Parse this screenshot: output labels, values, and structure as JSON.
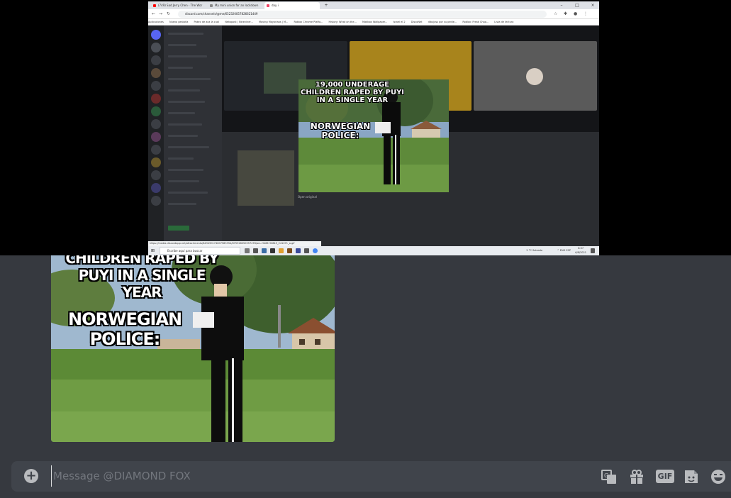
{
  "browser": {
    "tabs": [
      {
        "label": "(749) Sad Jerry Chen - The Wor",
        "color": "#ff0000"
      },
      {
        "label": "My mini union for an lockdown",
        "color": "#888888"
      },
      {
        "label": "day i",
        "color": "#ee4466"
      }
    ],
    "url": "discord.com/channels/@me/652320057826621449",
    "bookmarks": [
      "Aplicaciones",
      "Nuevo pestaña",
      "Pokec de aca la cual",
      "Nekopost | Nineviner...",
      "Moving Mayoriaos | M...",
      "Roblox Chrome Platfo...",
      "History: What on the...",
      "Madbox Wallpaper...",
      "Israel el 2",
      "DiscoNet",
      "dibujoss por su pedie...",
      "Roblox: Freak Chao...",
      "Lista de lectura"
    ],
    "status_url": "https://media.discordapp.net/attachments/843490174607983354/875328050557478/anu 3486 32845_241071_a.gif"
  },
  "meme": {
    "top_text": "19,000 UNDERAGE CHILDREN RAPED BY PUYI IN A SINGLE YEAR",
    "top_text_cropped": "CHILDREN RAPED BY PUYI IN A SINGLE YEAR",
    "bottom_text": "NORWEGIAN POLICE:"
  },
  "screenshot_chat": {
    "open_original": "Open original"
  },
  "taskbar": {
    "start_glyph": "⊞",
    "search_placeholder": "Escribe aquí para buscar",
    "weather": "2 °C  Soleado",
    "tray": "^ ENG ESP",
    "time": "8:07",
    "date": "6/8/2021"
  },
  "composer": {
    "placeholder": "Message @DIAMOND FOX",
    "attach_glyph": "+",
    "gif_label": "GIF"
  },
  "colors": {
    "background": "#36393f",
    "composer": "#40444b",
    "icon": "#b9bbbe",
    "placeholder": "#72767d"
  }
}
